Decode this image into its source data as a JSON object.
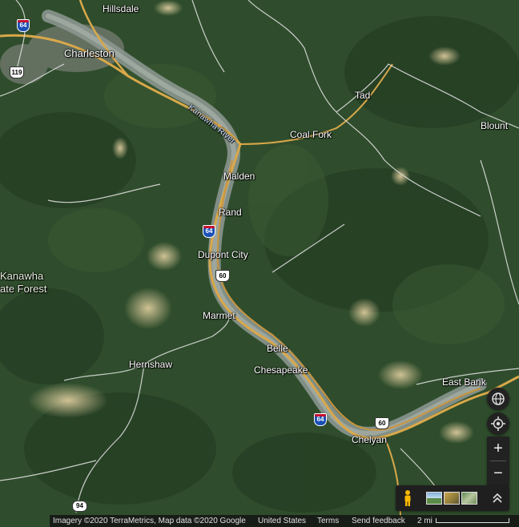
{
  "map": {
    "places": {
      "hillsdale": "Hillsdale",
      "charleston": "Charleston",
      "tad": "Tad",
      "blount": "Blount",
      "coal_fork": "Coal Fork",
      "malden": "Malden",
      "rand": "Rand",
      "dupont_city": "Dupont City",
      "marmet": "Marmet",
      "belle": "Belle",
      "chesapeake": "Chesapeake",
      "hernshaw": "Hernshaw",
      "east_bank": "East Bank",
      "chelyan": "Chelyan",
      "kanawha_forest_line1": "Kanawha",
      "kanawha_forest_line2": "ate Forest"
    },
    "river_label": "Kanawha River",
    "shields": {
      "i64_north": "64",
      "us119": "119",
      "i64_mid": "64",
      "us60_mid": "60",
      "i64_south": "64",
      "us60_south": "60",
      "wv94": "94"
    }
  },
  "controls": {
    "globe": "globe-icon",
    "location": "my-location-icon",
    "zoom_in": "+",
    "zoom_out": "−",
    "pegman": "pegman-icon",
    "expand": "expand-icon"
  },
  "footer": {
    "imagery": "Imagery ©2020 TerraMetrics, Map data ©2020 Google",
    "country": "United States",
    "terms": "Terms",
    "feedback": "Send feedback",
    "scale": "2 mi"
  },
  "colors": {
    "forest": "#2f4d2c",
    "forest_dark": "#1f3a1f",
    "river": "#8c9a94",
    "road_yellow": "#d9a84a",
    "road_white": "#e6e6e6",
    "cleared": "#c9b98a"
  }
}
